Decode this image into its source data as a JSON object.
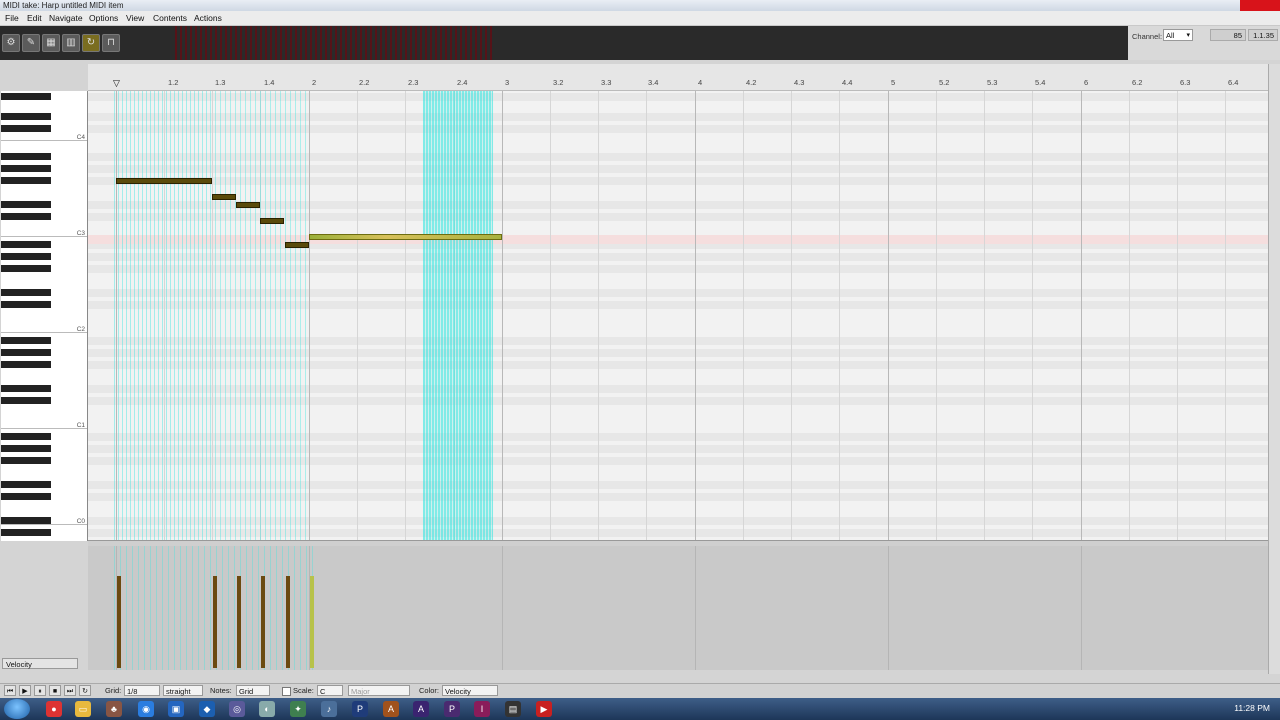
{
  "window": {
    "title": "MIDI take: Harp untitled MIDI item"
  },
  "menu": [
    "File",
    "Edit",
    "Navigate",
    "Options",
    "View",
    "Contents",
    "Actions"
  ],
  "toolbar": {
    "channel_label": "Channel:",
    "channel_value": "All",
    "value1": "85",
    "value2": "1.1.35"
  },
  "ruler": {
    "ticks": [
      "1.2",
      "1.3",
      "1.4",
      "2",
      "2.2",
      "2.3",
      "2.4",
      "3",
      "3.2",
      "3.3",
      "3.4",
      "4",
      "4.2",
      "4.3",
      "4.4",
      "5",
      "5.2",
      "5.3",
      "5.4",
      "6",
      "6.2",
      "6.3",
      "6.4"
    ]
  },
  "keyboard": {
    "octave_labels": [
      "C4",
      "C3",
      "C2",
      "C1",
      "C0"
    ]
  },
  "lane": {
    "selector": "Velocity"
  },
  "bottombar": {
    "grid_label": "Grid:",
    "grid_value": "1/8",
    "grid_type": "straight",
    "notes_label": "Notes:",
    "notes_value": "Grid",
    "scale_label": "Scale:",
    "scale_key": "C",
    "scale_type": "Major",
    "color_label": "Color:",
    "color_value": "Velocity"
  },
  "taskbar": {
    "clock": "11:28 PM"
  },
  "colors": {
    "note": "#5a4a0a",
    "selected_note": "#d7c05a",
    "glitch": "#35e6e0",
    "background": "#f2f2f2"
  }
}
